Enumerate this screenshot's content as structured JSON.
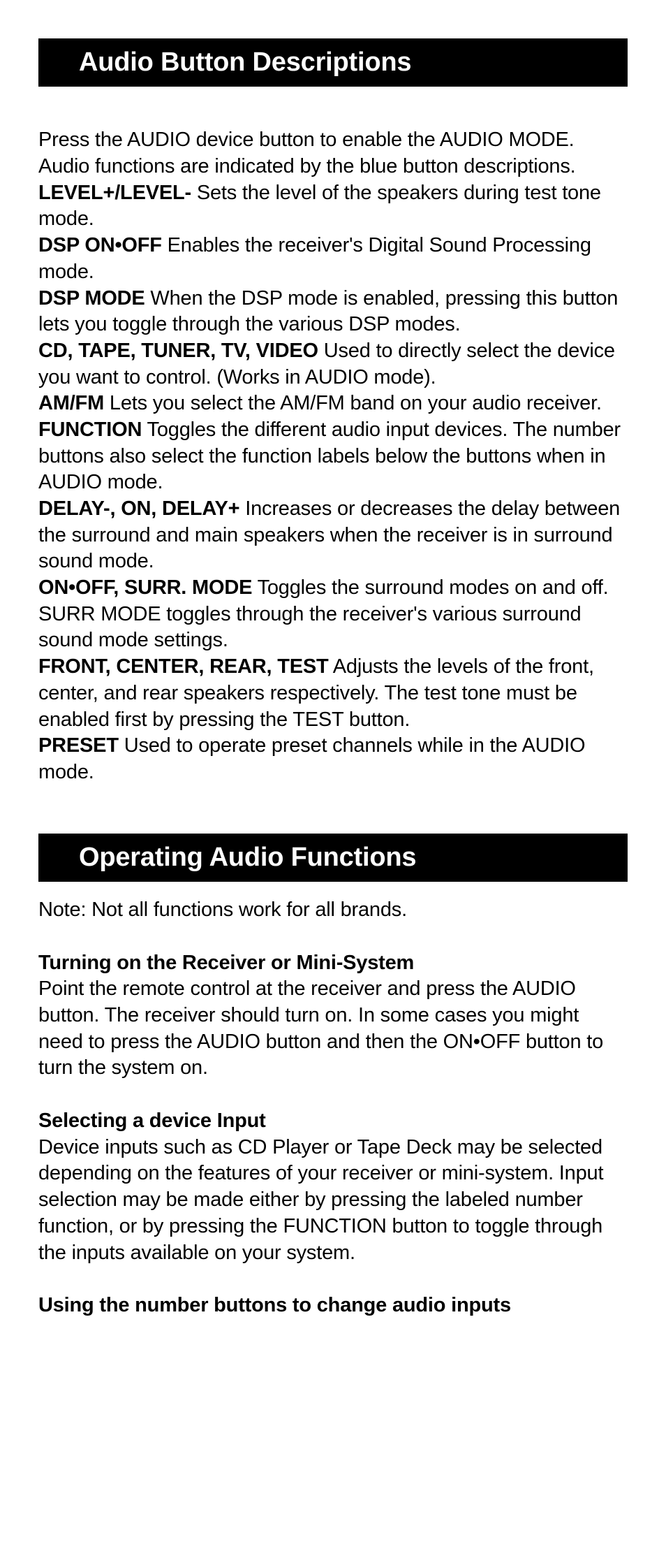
{
  "section1": {
    "title": "Audio Button Descriptions",
    "intro": "Press the AUDIO device button to enable the AUDIO MODE. Audio functions are indicated by the blue button descrip­tions.",
    "defs": [
      {
        "term": "LEVEL+/LEVEL-",
        "desc": " Sets the level of the speakers during test tone mode."
      },
      {
        "term": "DSP ON•OFF",
        "desc": " Enables the receiver's Digital Sound Process­ing mode."
      },
      {
        "term": "DSP MODE",
        "desc": " When the DSP mode is enabled, pressing this button lets you toggle through the various DSP modes."
      },
      {
        "term": "CD, TAPE, TUNER, TV, VIDEO",
        "desc": " Used to directly select the device you want to control. (Works in AUDIO mode)."
      },
      {
        "term": "AM/FM",
        "desc": " Lets you select the AM/FM band on your audio receiver."
      },
      {
        "term": "FUNCTION",
        "desc": " Toggles the different audio input devices. The number buttons also select the function labels below the buttons when in AUDIO mode."
      },
      {
        "term": "DELAY-, ON, DELAY+",
        "desc": " Increases or decreases the delay be­tween the surround and main speakers when the receiver is in surround sound mode."
      },
      {
        "term": "ON•OFF, SURR. MODE",
        "desc": " Toggles the surround modes on and off. SURR MODE toggles through the receiver's various surround sound mode settings."
      },
      {
        "term": "FRONT, CENTER, REAR, TEST",
        "desc": " Adjusts the levels of the front, center, and rear speakers respectively. The test tone must be enabled first by pressing the TEST button."
      },
      {
        "term": "PRESET",
        "desc": " Used to operate preset channels while in the AUDIO mode."
      }
    ]
  },
  "section2": {
    "title": "Operating Audio Functions",
    "note": "Note: Not all functions work for all brands.",
    "subs": [
      {
        "head": "Turning on the Receiver or Mini-System",
        "body": "Point the remote control at the receiver and press the AUDIO button. The receiver should turn on. In some cases you might need to press the AUDIO button and then the ON•OFF button to turn the system on."
      },
      {
        "head": "Selecting a device Input",
        "body": "Device inputs such as CD Player or Tape Deck may be selected depending on the features of your receiver or mini-system. Input selection may be made either by pressing the labeled number function, or by pressing the FUNCTION but­ton to toggle through the inputs available on your system."
      },
      {
        "head": "Using the number buttons to change audio inputs",
        "body": ""
      }
    ]
  }
}
